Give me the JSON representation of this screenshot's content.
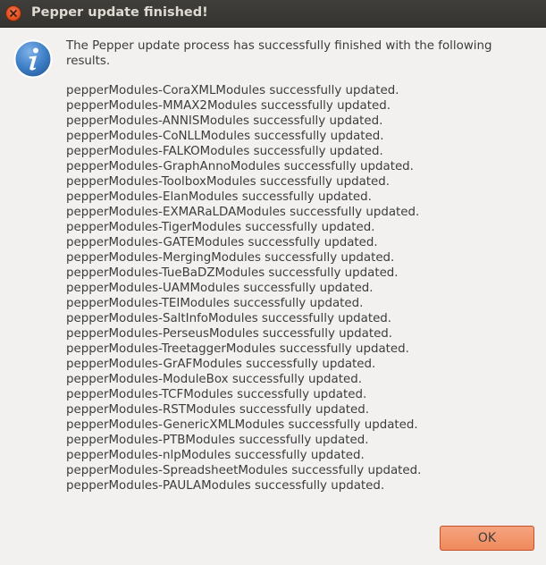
{
  "window": {
    "title": "Pepper update finished!"
  },
  "icons": {
    "close": "close-icon",
    "info": "info-icon"
  },
  "dialog": {
    "intro": "The Pepper update process has successfully finished with the following results.",
    "results": [
      "pepperModules-CoraXMLModules successfully updated.",
      "pepperModules-MMAX2Modules successfully updated.",
      "pepperModules-ANNISModules successfully updated.",
      "pepperModules-CoNLLModules successfully updated.",
      "pepperModules-FALKOModules successfully updated.",
      "pepperModules-GraphAnnoModules successfully updated.",
      "pepperModules-ToolboxModules successfully updated.",
      "pepperModules-ElanModules successfully updated.",
      "pepperModules-EXMARaLDAModules successfully updated.",
      "pepperModules-TigerModules successfully updated.",
      "pepperModules-GATEModules successfully updated.",
      "pepperModules-MergingModules successfully updated.",
      "pepperModules-TueBaDZModules successfully updated.",
      "pepperModules-UAMModules successfully updated.",
      "pepperModules-TEIModules successfully updated.",
      "pepperModules-SaltInfoModules successfully updated.",
      "pepperModules-PerseusModules successfully updated.",
      "pepperModules-TreetaggerModules successfully updated.",
      "pepperModules-GrAFModules successfully updated.",
      "pepperModules-ModuleBox successfully updated.",
      "pepperModules-TCFModules successfully updated.",
      "pepperModules-RSTModules successfully updated.",
      "pepperModules-GenericXMLModules successfully updated.",
      "pepperModules-PTBModules successfully updated.",
      "pepperModules-nlpModules successfully updated.",
      "pepperModules-SpreadsheetModules successfully updated.",
      "pepperModules-PAULAModules successfully updated."
    ],
    "ok_label": "OK"
  },
  "colors": {
    "titlebar": "#3c3b37",
    "close_button": "#df4b16",
    "ok_button": "#f0955f",
    "info_icon": "#3d7fc6",
    "background": "#f2f1f0"
  }
}
